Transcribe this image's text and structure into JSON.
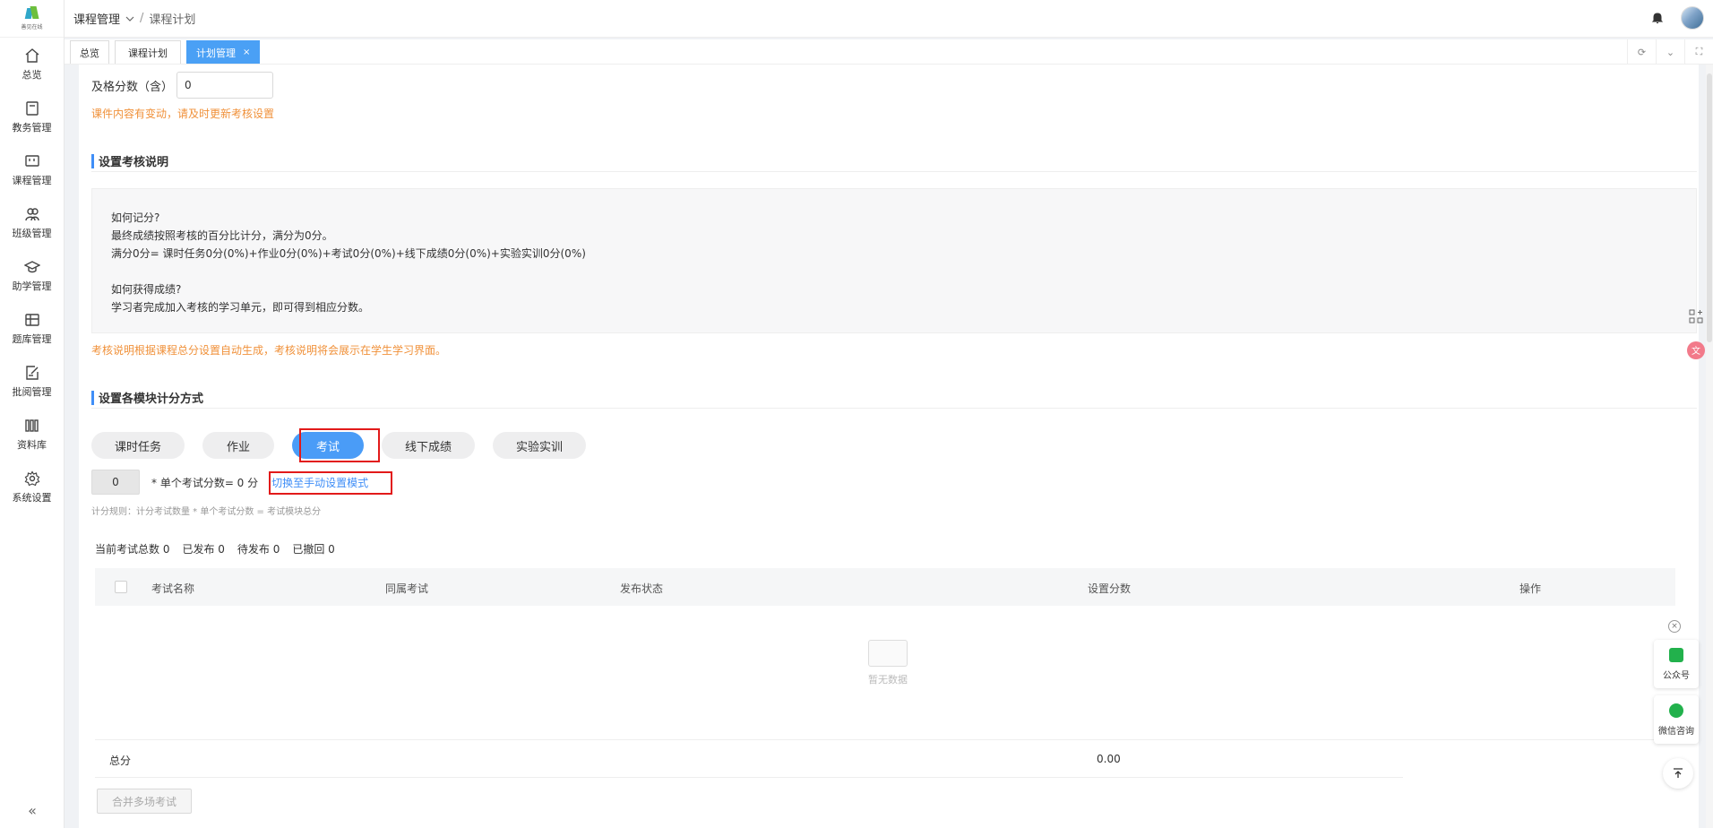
{
  "sidebar": {
    "logo_text": "善见在线",
    "items": [
      {
        "label": "总览",
        "icon": "home-icon"
      },
      {
        "label": "教务管理",
        "icon": "book-icon"
      },
      {
        "label": "课程管理",
        "icon": "board-icon"
      },
      {
        "label": "班级管理",
        "icon": "users-icon"
      },
      {
        "label": "助学管理",
        "icon": "graduation-cap-icon"
      },
      {
        "label": "题库管理",
        "icon": "question-bank-icon"
      },
      {
        "label": "批阅管理",
        "icon": "review-icon"
      },
      {
        "label": "资料库",
        "icon": "library-icon"
      },
      {
        "label": "系统设置",
        "icon": "gear-icon"
      }
    ],
    "collapse": "«"
  },
  "header": {
    "breadcrumb_parent": "课程管理",
    "breadcrumb_sep": "/",
    "breadcrumb_current": "课程计划"
  },
  "tabs": [
    {
      "label": "总览"
    },
    {
      "label": "课程计划"
    },
    {
      "label": "计划管理",
      "close": "×"
    }
  ],
  "pass": {
    "label": "及格分数（含）",
    "value": "0"
  },
  "warning_update": "课件内容有变动，请及时更新考核设置",
  "section_desc": {
    "title": "设置考核说明",
    "lines": [
      "如何记分?",
      "最终成绩按照考核的百分比计分，满分为0分。",
      "满分0分= 课时任务0分(0%)+作业0分(0%)+考试0分(0%)+线下成绩0分(0%)+实验实训0分(0%)",
      "",
      "如何获得成绩?",
      "学习者完成加入考核的学习单元，即可得到相应分数。"
    ],
    "note": "考核说明根据课程总分设置自动生成，考核说明将会展示在学生学习界面。"
  },
  "section_modules": {
    "title": "设置各模块计分方式",
    "pills": [
      "课时任务",
      "作业",
      "考试",
      "线下成绩",
      "实验实训"
    ],
    "active": "考试",
    "count_value": "0",
    "score_eq": "* 单个考试分数= 0 分",
    "switch_link": "切换至手动设置模式",
    "rule": "计分规则：计分考试数量 * 单个考试分数 = 考试模块总分"
  },
  "stats": {
    "total": "当前考试总数 0",
    "published": "已发布 0",
    "pending": "待发布 0",
    "revoked": "已撤回 0"
  },
  "table": {
    "columns": [
      "考试名称",
      "同属考试",
      "发布状态",
      "设置分数",
      "操作"
    ],
    "empty_text": "暂无数据",
    "footer_label": "总分",
    "footer_value": "0.00"
  },
  "merge_button": "合并多场考试",
  "floating": {
    "public_account": "公众号",
    "wechat_consult": "微信咨询",
    "close": "×"
  },
  "colors": {
    "primary": "#4a9cf7",
    "warning": "#f0913a",
    "highlight": "#e21a1a",
    "wechat": "#22b14c"
  }
}
